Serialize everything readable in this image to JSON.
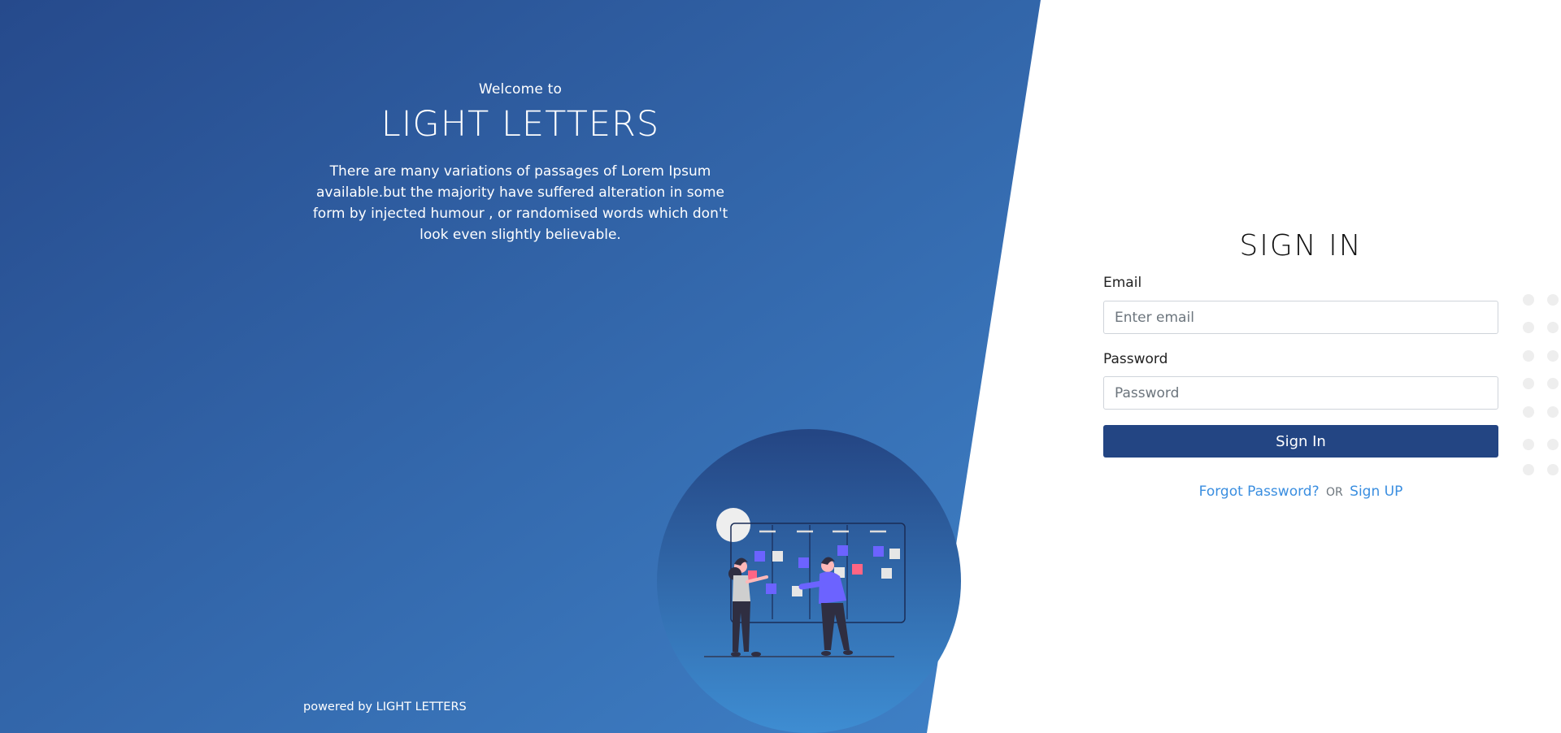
{
  "hero": {
    "welcome": "Welcome to",
    "title": "LIGHT LETTERS",
    "description": "There are many variations of passages of Lorem Ipsum available.but the majority have suffered alteration in some form by injected humour , or randomised words which don't look even slightly believable.",
    "powered_by": "powered by LIGHT LETTERS"
  },
  "signin": {
    "title": "SIGN IN",
    "email_label": "Email",
    "email_placeholder": "Enter email",
    "email_value": "",
    "password_label": "Password",
    "password_placeholder": "Password",
    "password_value": "",
    "submit_label": "Sign In",
    "forgot_password": "Forgot Password?",
    "or_text": "OR",
    "sign_up": "Sign UP"
  },
  "colors": {
    "hero_gradient_start": "#264a8c",
    "hero_gradient_end": "#3f82c8",
    "button": "#234583",
    "link": "#3a8ee0",
    "illustration_accent": "#6c63ff",
    "illustration_pink": "#ff6584"
  },
  "icons": {
    "illustration": "team-kanban-board-illustration",
    "decoration": "dot-grid-decoration"
  }
}
